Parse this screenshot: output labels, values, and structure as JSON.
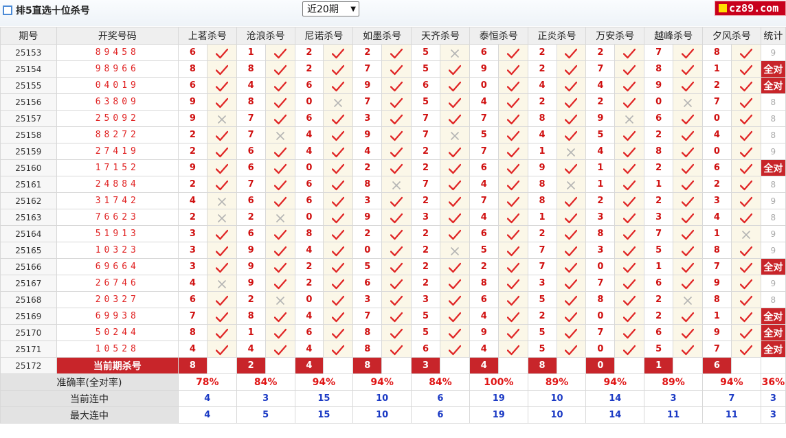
{
  "header": {
    "title": "排5直选十位杀号",
    "period_select": "近20期",
    "brand": "cz89.com"
  },
  "columns": {
    "issue": "期号",
    "draw": "开奖号码",
    "stat": "统计",
    "experts": [
      "上茗杀号",
      "沧浪杀号",
      "尼诺杀号",
      "如墨杀号",
      "天齐杀号",
      "泰恒杀号",
      "正炎杀号",
      "万安杀号",
      "越峰杀号",
      "夕风杀号"
    ]
  },
  "rows": [
    {
      "issue": "25153",
      "draw": "89458",
      "kills": [
        "6",
        "1",
        "2",
        "2",
        "5",
        "6",
        "2",
        "2",
        "7",
        "8"
      ],
      "hits": [
        1,
        1,
        1,
        1,
        0,
        1,
        1,
        1,
        1,
        1
      ],
      "stat": "9",
      "full": false
    },
    {
      "issue": "25154",
      "draw": "98966",
      "kills": [
        "8",
        "8",
        "2",
        "7",
        "5",
        "9",
        "2",
        "7",
        "8",
        "1"
      ],
      "hits": [
        1,
        1,
        1,
        1,
        1,
        1,
        1,
        1,
        1,
        1
      ],
      "stat": "全对",
      "full": true
    },
    {
      "issue": "25155",
      "draw": "04019",
      "kills": [
        "6",
        "4",
        "6",
        "9",
        "6",
        "0",
        "4",
        "4",
        "9",
        "2"
      ],
      "hits": [
        1,
        1,
        1,
        1,
        1,
        1,
        1,
        1,
        1,
        1
      ],
      "stat": "全对",
      "full": true
    },
    {
      "issue": "25156",
      "draw": "63809",
      "kills": [
        "9",
        "8",
        "0",
        "7",
        "5",
        "4",
        "2",
        "2",
        "0",
        "7"
      ],
      "hits": [
        1,
        1,
        0,
        1,
        1,
        1,
        1,
        1,
        0,
        1
      ],
      "stat": "8",
      "full": false
    },
    {
      "issue": "25157",
      "draw": "25092",
      "kills": [
        "9",
        "7",
        "6",
        "3",
        "7",
        "7",
        "8",
        "9",
        "6",
        "0"
      ],
      "hits": [
        0,
        1,
        1,
        1,
        1,
        1,
        1,
        0,
        1,
        1
      ],
      "stat": "8",
      "full": false
    },
    {
      "issue": "25158",
      "draw": "88272",
      "kills": [
        "2",
        "7",
        "4",
        "9",
        "7",
        "5",
        "4",
        "5",
        "2",
        "4"
      ],
      "hits": [
        1,
        0,
        1,
        1,
        0,
        1,
        1,
        1,
        1,
        1
      ],
      "stat": "8",
      "full": false
    },
    {
      "issue": "25159",
      "draw": "27419",
      "kills": [
        "2",
        "6",
        "4",
        "4",
        "2",
        "7",
        "1",
        "4",
        "8",
        "0"
      ],
      "hits": [
        1,
        1,
        1,
        1,
        1,
        1,
        0,
        1,
        1,
        1
      ],
      "stat": "9",
      "full": false
    },
    {
      "issue": "25160",
      "draw": "17152",
      "kills": [
        "9",
        "6",
        "0",
        "2",
        "2",
        "6",
        "9",
        "1",
        "2",
        "6"
      ],
      "hits": [
        1,
        1,
        1,
        1,
        1,
        1,
        1,
        1,
        1,
        1
      ],
      "stat": "全对",
      "full": true
    },
    {
      "issue": "25161",
      "draw": "24884",
      "kills": [
        "2",
        "7",
        "6",
        "8",
        "7",
        "4",
        "8",
        "1",
        "1",
        "2"
      ],
      "hits": [
        1,
        1,
        1,
        0,
        1,
        1,
        0,
        1,
        1,
        1
      ],
      "stat": "8",
      "full": false
    },
    {
      "issue": "25162",
      "draw": "31742",
      "kills": [
        "4",
        "6",
        "6",
        "3",
        "2",
        "7",
        "8",
        "2",
        "2",
        "3"
      ],
      "hits": [
        0,
        1,
        1,
        1,
        1,
        1,
        1,
        1,
        1,
        1
      ],
      "stat": "9",
      "full": false
    },
    {
      "issue": "25163",
      "draw": "76623",
      "kills": [
        "2",
        "2",
        "0",
        "9",
        "3",
        "4",
        "1",
        "3",
        "3",
        "4"
      ],
      "hits": [
        0,
        0,
        1,
        1,
        1,
        1,
        1,
        1,
        1,
        1
      ],
      "stat": "8",
      "full": false
    },
    {
      "issue": "25164",
      "draw": "51913",
      "kills": [
        "3",
        "6",
        "8",
        "2",
        "2",
        "6",
        "2",
        "8",
        "7",
        "1"
      ],
      "hits": [
        1,
        1,
        1,
        1,
        1,
        1,
        1,
        1,
        1,
        0
      ],
      "stat": "9",
      "full": false
    },
    {
      "issue": "25165",
      "draw": "10323",
      "kills": [
        "3",
        "9",
        "4",
        "0",
        "2",
        "5",
        "7",
        "3",
        "5",
        "8"
      ],
      "hits": [
        1,
        1,
        1,
        1,
        0,
        1,
        1,
        1,
        1,
        1
      ],
      "stat": "9",
      "full": false
    },
    {
      "issue": "25166",
      "draw": "69664",
      "kills": [
        "3",
        "9",
        "2",
        "5",
        "2",
        "2",
        "7",
        "0",
        "1",
        "7"
      ],
      "hits": [
        1,
        1,
        1,
        1,
        1,
        1,
        1,
        1,
        1,
        1
      ],
      "stat": "全对",
      "full": true
    },
    {
      "issue": "25167",
      "draw": "26746",
      "kills": [
        "4",
        "9",
        "2",
        "6",
        "2",
        "8",
        "3",
        "7",
        "6",
        "9"
      ],
      "hits": [
        0,
        1,
        1,
        1,
        1,
        1,
        1,
        1,
        1,
        1
      ],
      "stat": "9",
      "full": false
    },
    {
      "issue": "25168",
      "draw": "20327",
      "kills": [
        "6",
        "2",
        "0",
        "3",
        "3",
        "6",
        "5",
        "8",
        "2",
        "8"
      ],
      "hits": [
        1,
        0,
        1,
        1,
        1,
        1,
        1,
        1,
        0,
        1
      ],
      "stat": "8",
      "full": false
    },
    {
      "issue": "25169",
      "draw": "69938",
      "kills": [
        "7",
        "8",
        "4",
        "7",
        "5",
        "4",
        "2",
        "0",
        "2",
        "1"
      ],
      "hits": [
        1,
        1,
        1,
        1,
        1,
        1,
        1,
        1,
        1,
        1
      ],
      "stat": "全对",
      "full": true
    },
    {
      "issue": "25170",
      "draw": "50244",
      "kills": [
        "8",
        "1",
        "6",
        "8",
        "5",
        "9",
        "5",
        "7",
        "6",
        "9"
      ],
      "hits": [
        1,
        1,
        1,
        1,
        1,
        1,
        1,
        1,
        1,
        1
      ],
      "stat": "全对",
      "full": true
    },
    {
      "issue": "25171",
      "draw": "10528",
      "kills": [
        "4",
        "4",
        "4",
        "8",
        "6",
        "4",
        "5",
        "0",
        "5",
        "7"
      ],
      "hits": [
        1,
        1,
        1,
        1,
        1,
        1,
        1,
        1,
        1,
        1
      ],
      "stat": "全对",
      "full": true
    }
  ],
  "current": {
    "issue": "25172",
    "label": "当前期杀号",
    "kills": [
      "8",
      "2",
      "4",
      "8",
      "3",
      "4",
      "8",
      "0",
      "1",
      "6"
    ]
  },
  "summary": {
    "accuracy_label": "准确率(全对率)",
    "accuracy": [
      "78%",
      "84%",
      "94%",
      "94%",
      "84%",
      "100%",
      "89%",
      "94%",
      "89%",
      "94%"
    ],
    "accuracy_stat": "36%",
    "streak_label": "当前连中",
    "streak": [
      "4",
      "3",
      "15",
      "10",
      "6",
      "19",
      "10",
      "14",
      "3",
      "7"
    ],
    "streak_stat": "3",
    "max_label": "最大连中",
    "max": [
      "4",
      "5",
      "15",
      "10",
      "6",
      "19",
      "10",
      "14",
      "11",
      "11"
    ],
    "max_stat": "3"
  },
  "colors": {
    "hit": "#e02626",
    "miss": "#b4b4b4",
    "full_bg": "#c8252a",
    "accuracy": "#e01515",
    "streak": "#1a39c4"
  },
  "icons": {
    "hit": "check-icon",
    "miss": "cross-icon"
  }
}
